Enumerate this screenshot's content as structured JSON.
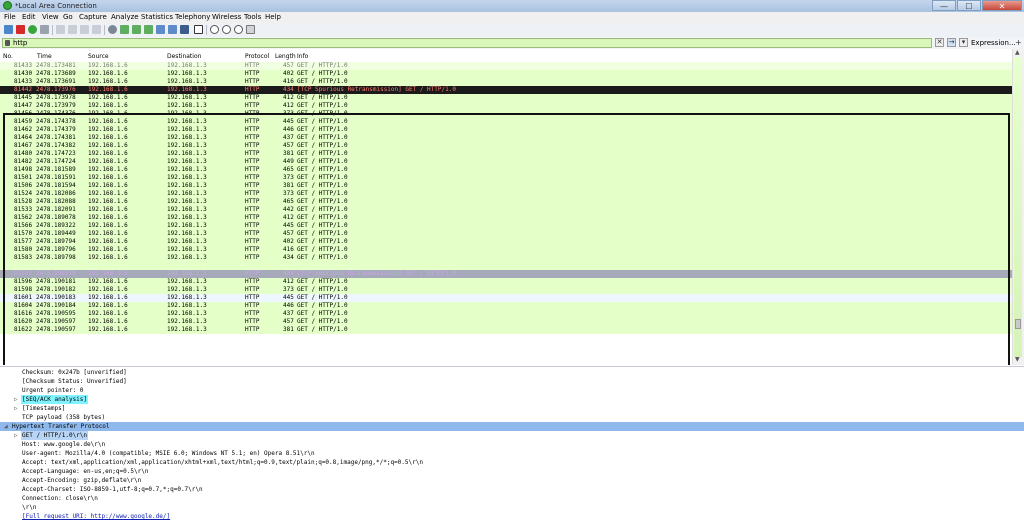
{
  "window": {
    "title": "*Local Area Connection",
    "minimize": "—",
    "maximize": "☐",
    "close": "✕"
  },
  "menu": [
    "File",
    "Edit",
    "View",
    "Go",
    "Capture",
    "Analyze",
    "Statistics",
    "Telephony",
    "Wireless",
    "Tools",
    "Help"
  ],
  "filter": {
    "value": "http",
    "expression_label": "Expression...",
    "plus": "+"
  },
  "columns": [
    "No.",
    "Time",
    "Source",
    "Destination",
    "Protocol",
    "Length",
    "Info"
  ],
  "packets": [
    {
      "no": "81433",
      "time": "2478.173481",
      "src": "192.168.1.6",
      "dst": "192.168.1.3",
      "proto": "HTTP",
      "len": "457",
      "info": "GET / HTTP/1.0",
      "style": "partial"
    },
    {
      "no": "81430",
      "time": "2478.173689",
      "src": "192.168.1.6",
      "dst": "192.168.1.3",
      "proto": "HTTP",
      "len": "402",
      "info": "GET / HTTP/1.0",
      "style": ""
    },
    {
      "no": "81433",
      "time": "2478.173691",
      "src": "192.168.1.6",
      "dst": "192.168.1.3",
      "proto": "HTTP",
      "len": "416",
      "info": "GET / HTTP/1.0",
      "style": ""
    },
    {
      "no": "81442",
      "time": "2478.173976",
      "src": "192.168.1.6",
      "dst": "192.168.1.3",
      "proto": "HTTP",
      "len": "434",
      "info": "[TCP Spurious Retransmission] GET / HTTP/1.0",
      "style": "sel"
    },
    {
      "no": "81445",
      "time": "2478.173978",
      "src": "192.168.1.6",
      "dst": "192.168.1.3",
      "proto": "HTTP",
      "len": "412",
      "info": "GET / HTTP/1.0",
      "style": ""
    },
    {
      "no": "81447",
      "time": "2478.173979",
      "src": "192.168.1.6",
      "dst": "192.168.1.3",
      "proto": "HTTP",
      "len": "412",
      "info": "GET / HTTP/1.0",
      "style": ""
    },
    {
      "no": "81456",
      "time": "2478.174376",
      "src": "192.168.1.6",
      "dst": "192.168.1.3",
      "proto": "HTTP",
      "len": "373",
      "info": "GET / HTTP/1.0",
      "style": ""
    },
    {
      "no": "81459",
      "time": "2478.174378",
      "src": "192.168.1.6",
      "dst": "192.168.1.3",
      "proto": "HTTP",
      "len": "445",
      "info": "GET / HTTP/1.0",
      "style": ""
    },
    {
      "no": "81462",
      "time": "2478.174379",
      "src": "192.168.1.6",
      "dst": "192.168.1.3",
      "proto": "HTTP",
      "len": "446",
      "info": "GET / HTTP/1.0",
      "style": ""
    },
    {
      "no": "81464",
      "time": "2478.174381",
      "src": "192.168.1.6",
      "dst": "192.168.1.3",
      "proto": "HTTP",
      "len": "437",
      "info": "GET / HTTP/1.0",
      "style": ""
    },
    {
      "no": "81467",
      "time": "2478.174382",
      "src": "192.168.1.6",
      "dst": "192.168.1.3",
      "proto": "HTTP",
      "len": "457",
      "info": "GET / HTTP/1.0",
      "style": ""
    },
    {
      "no": "81480",
      "time": "2478.174723",
      "src": "192.168.1.6",
      "dst": "192.168.1.3",
      "proto": "HTTP",
      "len": "381",
      "info": "GET / HTTP/1.0",
      "style": ""
    },
    {
      "no": "81482",
      "time": "2478.174724",
      "src": "192.168.1.6",
      "dst": "192.168.1.3",
      "proto": "HTTP",
      "len": "449",
      "info": "GET / HTTP/1.0",
      "style": ""
    },
    {
      "no": "81498",
      "time": "2478.181589",
      "src": "192.168.1.6",
      "dst": "192.168.1.3",
      "proto": "HTTP",
      "len": "465",
      "info": "GET / HTTP/1.0",
      "style": ""
    },
    {
      "no": "81501",
      "time": "2478.181591",
      "src": "192.168.1.6",
      "dst": "192.168.1.3",
      "proto": "HTTP",
      "len": "373",
      "info": "GET / HTTP/1.0",
      "style": ""
    },
    {
      "no": "81506",
      "time": "2478.181594",
      "src": "192.168.1.6",
      "dst": "192.168.1.3",
      "proto": "HTTP",
      "len": "381",
      "info": "GET / HTTP/1.0",
      "style": ""
    },
    {
      "no": "81524",
      "time": "2478.182086",
      "src": "192.168.1.6",
      "dst": "192.168.1.3",
      "proto": "HTTP",
      "len": "373",
      "info": "GET / HTTP/1.0",
      "style": ""
    },
    {
      "no": "81528",
      "time": "2478.182088",
      "src": "192.168.1.6",
      "dst": "192.168.1.3",
      "proto": "HTTP",
      "len": "465",
      "info": "GET / HTTP/1.0",
      "style": ""
    },
    {
      "no": "81533",
      "time": "2478.182091",
      "src": "192.168.1.6",
      "dst": "192.168.1.3",
      "proto": "HTTP",
      "len": "442",
      "info": "GET / HTTP/1.0",
      "style": ""
    },
    {
      "no": "81562",
      "time": "2478.189078",
      "src": "192.168.1.6",
      "dst": "192.168.1.3",
      "proto": "HTTP",
      "len": "412",
      "info": "GET / HTTP/1.0",
      "style": ""
    },
    {
      "no": "81566",
      "time": "2478.189322",
      "src": "192.168.1.6",
      "dst": "192.168.1.3",
      "proto": "HTTP",
      "len": "445",
      "info": "GET / HTTP/1.0",
      "style": ""
    },
    {
      "no": "81570",
      "time": "2478.189449",
      "src": "192.168.1.6",
      "dst": "192.168.1.3",
      "proto": "HTTP",
      "len": "457",
      "info": "GET / HTTP/1.0",
      "style": ""
    },
    {
      "no": "81577",
      "time": "2478.189794",
      "src": "192.168.1.6",
      "dst": "192.168.1.3",
      "proto": "HTTP",
      "len": "402",
      "info": "GET / HTTP/1.0",
      "style": ""
    },
    {
      "no": "81580",
      "time": "2478.189796",
      "src": "192.168.1.6",
      "dst": "192.168.1.3",
      "proto": "HTTP",
      "len": "416",
      "info": "GET / HTTP/1.0",
      "style": ""
    },
    {
      "no": "81583",
      "time": "2478.189798",
      "src": "192.168.1.6",
      "dst": "192.168.1.3",
      "proto": "HTTP",
      "len": "434",
      "info": "GET / HTTP/1.0",
      "style": ""
    },
    {
      "no": "",
      "time": "",
      "src": "",
      "dst": "",
      "proto": "",
      "len": "",
      "info": "",
      "style": "blank"
    },
    {
      "no": "81592",
      "time": "2478.190179",
      "src": "192.168.1.6",
      "dst": "192.168.1.3",
      "proto": "HTTP",
      "len": "434",
      "info": "[TCP Spurious Retransmission] GET / HTTP/1.0",
      "style": "bad"
    },
    {
      "no": "81596",
      "time": "2478.190181",
      "src": "192.168.1.6",
      "dst": "192.168.1.3",
      "proto": "HTTP",
      "len": "412",
      "info": "GET / HTTP/1.0",
      "style": ""
    },
    {
      "no": "81598",
      "time": "2478.190182",
      "src": "192.168.1.6",
      "dst": "192.168.1.3",
      "proto": "HTTP",
      "len": "373",
      "info": "GET / HTTP/1.0",
      "style": ""
    },
    {
      "no": "81601",
      "time": "2478.190183",
      "src": "192.168.1.6",
      "dst": "192.168.1.3",
      "proto": "HTTP",
      "len": "445",
      "info": "GET / HTTP/1.0",
      "style": "alt"
    },
    {
      "no": "81604",
      "time": "2478.190184",
      "src": "192.168.1.6",
      "dst": "192.168.1.3",
      "proto": "HTTP",
      "len": "446",
      "info": "GET / HTTP/1.0",
      "style": ""
    },
    {
      "no": "81616",
      "time": "2478.190595",
      "src": "192.168.1.6",
      "dst": "192.168.1.3",
      "proto": "HTTP",
      "len": "437",
      "info": "GET / HTTP/1.0",
      "style": ""
    },
    {
      "no": "81620",
      "time": "2478.190597",
      "src": "192.168.1.6",
      "dst": "192.168.1.3",
      "proto": "HTTP",
      "len": "457",
      "info": "GET / HTTP/1.0",
      "style": ""
    },
    {
      "no": "81622",
      "time": "2478.190597",
      "src": "192.168.1.6",
      "dst": "192.168.1.3",
      "proto": "HTTP",
      "len": "381",
      "info": "GET / HTTP/1.0",
      "style": ""
    }
  ],
  "details": [
    {
      "text": "Checksum: 0x247b [unverified]",
      "indent": 3,
      "tri": "",
      "hl": ""
    },
    {
      "text": "[Checksum Status: Unverified]",
      "indent": 3,
      "tri": "",
      "hl": ""
    },
    {
      "text": "Urgent pointer: 0",
      "indent": 3,
      "tri": "",
      "hl": ""
    },
    {
      "text": "[SEQ/ACK analysis]",
      "indent": 3,
      "tri": "▷",
      "hl": "cyan"
    },
    {
      "text": "[Timestamps]",
      "indent": 3,
      "tri": "▷",
      "hl": ""
    },
    {
      "text": "TCP payload (358 bytes)",
      "indent": 3,
      "tri": "",
      "hl": ""
    },
    {
      "text": "Hypertext Transfer Protocol",
      "indent": 1,
      "tri": "◢",
      "hl": "blue"
    },
    {
      "text": "GET / HTTP/1.0\\r\\n",
      "indent": 3,
      "tri": "▷",
      "hl": "lightblue"
    },
    {
      "text": "Host: www.google.de\\r\\n",
      "indent": 3,
      "tri": "",
      "hl": ""
    },
    {
      "text": "User-agent: Mozilla/4.0 (compatible; MSIE 6.0; Windows NT 5.1; en) Opera 8.51\\r\\n",
      "indent": 3,
      "tri": "",
      "hl": ""
    },
    {
      "text": "Accept: text/xml,application/xml,application/xhtml+xml,text/html;q=0.9,text/plain;q=0.8,image/png,*/*;q=0.5\\r\\n",
      "indent": 3,
      "tri": "",
      "hl": ""
    },
    {
      "text": "Accept-Language: en-us,en;q=0.5\\r\\n",
      "indent": 3,
      "tri": "",
      "hl": ""
    },
    {
      "text": "Accept-Encoding: gzip,deflate\\r\\n",
      "indent": 3,
      "tri": "",
      "hl": ""
    },
    {
      "text": "Accept-Charset: ISO-8859-1,utf-8;q=0.7,*;q=0.7\\r\\n",
      "indent": 3,
      "tri": "",
      "hl": ""
    },
    {
      "text": "Connection: close\\r\\n",
      "indent": 3,
      "tri": "",
      "hl": ""
    },
    {
      "text": "\\r\\n",
      "indent": 3,
      "tri": "",
      "hl": ""
    },
    {
      "text": "[Full request URI: http://www.google.de/]",
      "indent": 3,
      "tri": "",
      "hl": "link"
    }
  ],
  "colors": {
    "filter_ok": "#d8f7b9",
    "http_row": "#e4ffc7",
    "selected_row": "#1a1a1a",
    "selected_text": "#ff7a6e",
    "bad_row": "#a5a9ba",
    "tree_blue": "#8fb9ec",
    "tree_cyan": "#7ff3ff"
  }
}
